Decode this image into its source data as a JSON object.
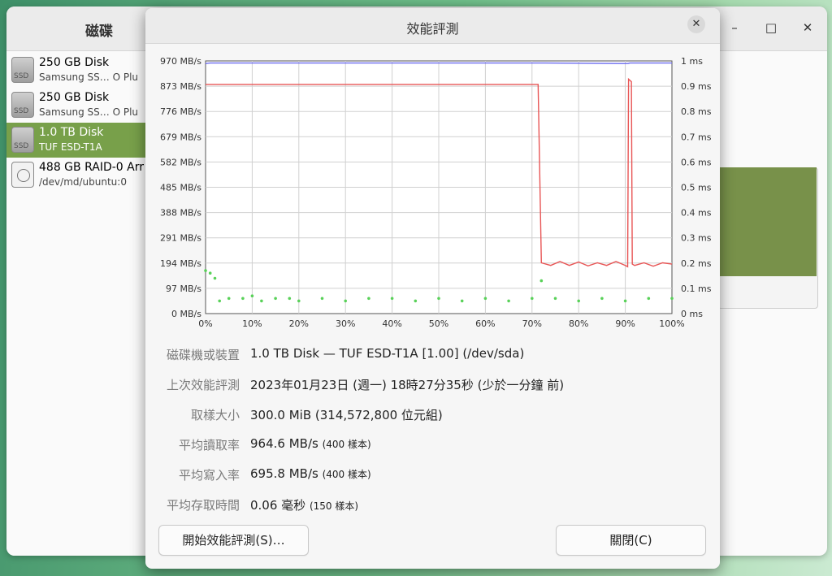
{
  "app": {
    "title": "磁碟",
    "controls": [
      "minimize-icon",
      "maximize-icon",
      "close-icon"
    ]
  },
  "sidebar": {
    "items": [
      {
        "name": "250 GB Disk",
        "sub": "Samsung SS…  O Plu",
        "icon": "ssd-icon",
        "icon_label": "SSD",
        "selected": false
      },
      {
        "name": "250 GB Disk",
        "sub": "Samsung SS…  O Plu",
        "icon": "ssd-icon",
        "icon_label": "SSD",
        "selected": false
      },
      {
        "name": "1.0 TB Disk",
        "sub": "TUF ESD-T1A",
        "icon": "ssd-icon",
        "icon_label": "SSD",
        "selected": true
      },
      {
        "name": "488 GB RAID-0 Arr",
        "sub": "/dev/md/ubuntu:0",
        "icon": "raid-icon",
        "icon_label": "",
        "selected": false
      }
    ]
  },
  "dialog": {
    "title": "效能評測",
    "close_icon": "close-icon",
    "info": {
      "device_label": "磁碟機或裝置",
      "device_value": "1.0 TB Disk — TUF ESD-T1A [1.00] (/dev/sda)",
      "last_label": "上次效能評測",
      "last_value": "2023年01月23日 (週一) 18時27分35秒 (少於一分鐘 前)",
      "sample_label": "取樣大小",
      "sample_value": "300.0 MiB (314,572,800 位元組)",
      "read_label": "平均讀取率",
      "read_value": "964.6 MB/s",
      "read_note": "(400 樣本)",
      "write_label": "平均寫入率",
      "write_value": "695.8 MB/s",
      "write_note": "(400 樣本)",
      "access_label": "平均存取時間",
      "access_value": "0.06 毫秒",
      "access_note": "(150 樣本)"
    },
    "buttons": {
      "start": "開始效能評測(S)…",
      "close": "關閉(C)"
    }
  },
  "colors": {
    "read_line": "#6b6bf0",
    "write_line": "#e85555",
    "access_points": "#59d159",
    "selected_bg": "#78a04a"
  },
  "chart_data": {
    "type": "line",
    "x_tick_labels": [
      "0%",
      "10%",
      "20%",
      "30%",
      "40%",
      "50%",
      "60%",
      "70%",
      "80%",
      "90%",
      "100%"
    ],
    "y_left_tick_labels": [
      "0 MB/s",
      "97 MB/s",
      "194 MB/s",
      "291 MB/s",
      "388 MB/s",
      "485 MB/s",
      "582 MB/s",
      "679 MB/s",
      "776 MB/s",
      "873 MB/s",
      "970 MB/s"
    ],
    "y_right_tick_labels": [
      "0 ms",
      "0.1 ms",
      "0.2 ms",
      "0.3 ms",
      "0.4 ms",
      "0.5 ms",
      "0.6 ms",
      "0.7 ms",
      "0.8 ms",
      "0.9 ms",
      "1 ms"
    ],
    "xlim": [
      0,
      100
    ],
    "ylim_left": [
      0,
      970
    ],
    "ylim_right": [
      0,
      1
    ],
    "grid": true,
    "series": [
      {
        "axis": "left",
        "style": "line",
        "x": [
          0,
          1,
          72,
          72.3,
          73,
          90,
          90.6,
          91,
          91.2,
          91.8,
          92,
          100
        ],
        "y": [
          960,
          962,
          962,
          962,
          962,
          960,
          960,
          962,
          962,
          962,
          962,
          962
        ]
      },
      {
        "axis": "left",
        "style": "line",
        "x": [
          0,
          71,
          71.3,
          72,
          74,
          76,
          78,
          80,
          82,
          84,
          86,
          88,
          90,
          90.5,
          90.7,
          91.3,
          91.5,
          92,
          94,
          96,
          98,
          100
        ],
        "y": [
          880,
          880,
          880,
          195,
          185,
          200,
          185,
          198,
          183,
          195,
          185,
          200,
          185,
          180,
          900,
          890,
          190,
          185,
          195,
          182,
          195,
          190
        ]
      },
      {
        "axis": "right",
        "style": "scatter",
        "x": [
          0,
          1,
          2,
          3,
          5,
          8,
          10,
          12,
          15,
          18,
          20,
          25,
          30,
          35,
          40,
          45,
          50,
          55,
          60,
          65,
          70,
          72,
          75,
          80,
          85,
          90,
          95,
          100
        ],
        "y": [
          0.17,
          0.16,
          0.14,
          0.05,
          0.06,
          0.06,
          0.07,
          0.05,
          0.06,
          0.06,
          0.05,
          0.06,
          0.05,
          0.06,
          0.06,
          0.05,
          0.06,
          0.05,
          0.06,
          0.05,
          0.06,
          0.13,
          0.06,
          0.05,
          0.06,
          0.05,
          0.06,
          0.06
        ]
      }
    ]
  }
}
